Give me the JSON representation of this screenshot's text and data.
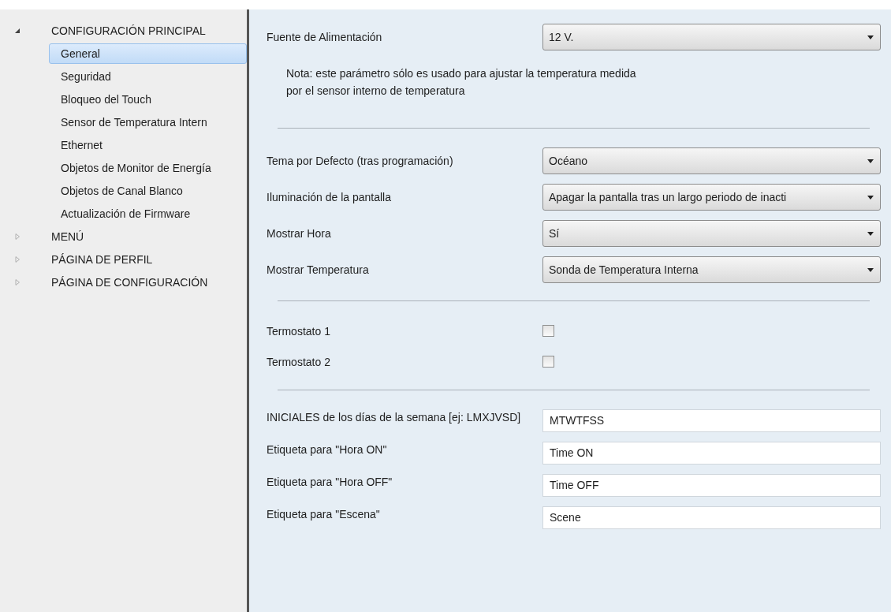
{
  "sidebar": {
    "items": [
      {
        "label": "CONFIGURACIÓN PRINCIPAL",
        "expanded": true,
        "selected": false,
        "children": [
          {
            "label": "General",
            "selected": true
          },
          {
            "label": "Seguridad",
            "selected": false
          },
          {
            "label": "Bloqueo del Touch",
            "selected": false
          },
          {
            "label": "Sensor de Temperatura Intern",
            "selected": false
          },
          {
            "label": "Ethernet",
            "selected": false
          },
          {
            "label": "Objetos de Monitor de Energía",
            "selected": false
          },
          {
            "label": "Objetos de Canal Blanco",
            "selected": false
          },
          {
            "label": "Actualización de Firmware",
            "selected": false
          }
        ]
      },
      {
        "label": "MENÚ",
        "expanded": false,
        "selected": false
      },
      {
        "label": "PÁGINA DE PERFIL",
        "expanded": false,
        "selected": false
      },
      {
        "label": "PÁGINA DE CONFIGURACIÓN",
        "expanded": false,
        "selected": false
      }
    ]
  },
  "sections": [
    {
      "rows": [
        {
          "kind": "select",
          "label": "Fuente de Alimentación",
          "value": "12 V."
        },
        {
          "kind": "note",
          "text": "Nota: este parámetro sólo es usado para ajustar la temperatura medida\npor el sensor interno de temperatura"
        }
      ]
    },
    {
      "rows": [
        {
          "kind": "select",
          "label": "Tema por Defecto (tras programación)",
          "value": "Océano"
        },
        {
          "kind": "select",
          "label": "Iluminación de la pantalla",
          "value": "Apagar la pantalla tras un largo periodo de inacti"
        },
        {
          "kind": "select",
          "label": "Mostrar Hora",
          "value": "Sí"
        },
        {
          "kind": "select",
          "label": "Mostrar Temperatura",
          "value": "Sonda de Temperatura Interna"
        }
      ]
    },
    {
      "rows": [
        {
          "kind": "checkbox",
          "label": "Termostato 1",
          "checked": false
        },
        {
          "kind": "checkbox",
          "label": "Termostato 2",
          "checked": false
        }
      ]
    },
    {
      "rows": [
        {
          "kind": "text",
          "label": "INICIALES de los días de la semana [ej: LMXJVSD]",
          "value": "MTWTFSS"
        },
        {
          "kind": "text",
          "label": "Etiqueta para \"Hora ON\"",
          "value": "Time ON"
        },
        {
          "kind": "text",
          "label": "Etiqueta para \"Hora OFF\"",
          "value": "Time OFF"
        },
        {
          "kind": "text",
          "label": "Etiqueta para \"Escena\"",
          "value": "Scene"
        }
      ]
    }
  ]
}
